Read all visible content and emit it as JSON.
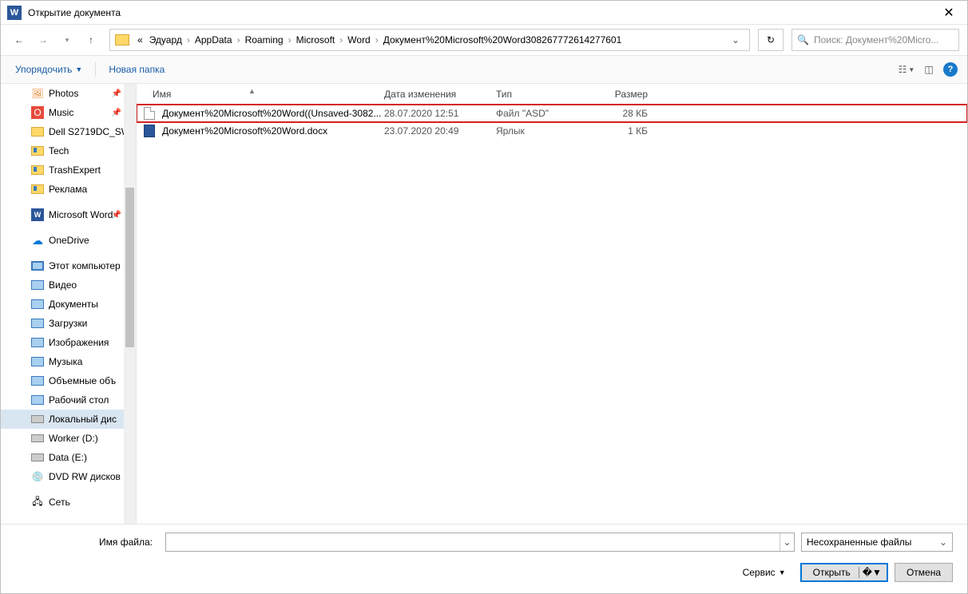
{
  "title": "Открытие документа",
  "breadcrumbs": [
    "Эдуард",
    "AppData",
    "Roaming",
    "Microsoft",
    "Word",
    "Документ%20Microsoft%20Word308267772614277601"
  ],
  "search_placeholder": "Поиск: Документ%20Micro...",
  "toolbar": {
    "organize": "Упорядочить",
    "newfolder": "Новая папка"
  },
  "columns": {
    "name": "Имя",
    "date": "Дата изменения",
    "type": "Тип",
    "size": "Размер"
  },
  "sidebar": [
    {
      "label": "Photos",
      "icon": "photos",
      "pinned": true
    },
    {
      "label": "Music",
      "icon": "music",
      "pinned": true
    },
    {
      "label": "Dell S2719DC_SW",
      "icon": "folder"
    },
    {
      "label": "Tech",
      "icon": "folder-ribbon"
    },
    {
      "label": "TrashExpert",
      "icon": "folder-ribbon"
    },
    {
      "label": "Реклама",
      "icon": "folder-ribbon"
    },
    {
      "label": "",
      "icon": "spacer"
    },
    {
      "label": "Microsoft Word",
      "icon": "word",
      "pinned": true
    },
    {
      "label": "",
      "icon": "spacer"
    },
    {
      "label": "OneDrive",
      "icon": "cloud"
    },
    {
      "label": "",
      "icon": "spacer"
    },
    {
      "label": "Этот компьютер",
      "icon": "monitor"
    },
    {
      "label": "Видео",
      "icon": "folder-sys"
    },
    {
      "label": "Документы",
      "icon": "folder-sys"
    },
    {
      "label": "Загрузки",
      "icon": "folder-sys"
    },
    {
      "label": "Изображения",
      "icon": "folder-sys"
    },
    {
      "label": "Музыка",
      "icon": "folder-sys"
    },
    {
      "label": "Объемные объ",
      "icon": "folder-sys"
    },
    {
      "label": "Рабочий стол",
      "icon": "folder-sys"
    },
    {
      "label": "Локальный дис",
      "icon": "drive",
      "selected": true
    },
    {
      "label": "Worker (D:)",
      "icon": "drive"
    },
    {
      "label": "Data (E:)",
      "icon": "drive"
    },
    {
      "label": "DVD RW дисков",
      "icon": "disc"
    },
    {
      "label": "",
      "icon": "spacer"
    },
    {
      "label": "Сеть",
      "icon": "network"
    }
  ],
  "files": [
    {
      "name": "Документ%20Microsoft%20Word((Unsaved-3082...",
      "date": "28.07.2020 12:51",
      "type": "Файл \"ASD\"",
      "size": "28 КБ",
      "icon": "file",
      "highlighted": true
    },
    {
      "name": "Документ%20Microsoft%20Word.docx",
      "date": "23.07.2020 20:49",
      "type": "Ярлык",
      "size": "1 КБ",
      "icon": "docx"
    }
  ],
  "footer": {
    "filename_label": "Имя файла:",
    "filter": "Несохраненные файлы",
    "service": "Сервис",
    "open": "Открыть",
    "cancel": "Отмена"
  }
}
